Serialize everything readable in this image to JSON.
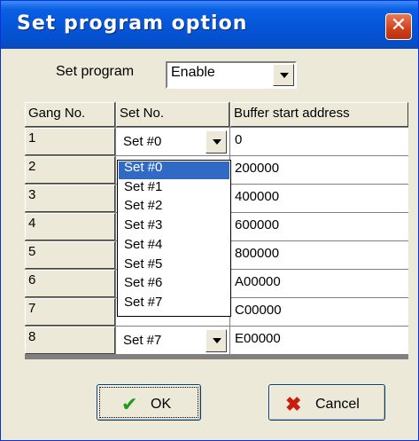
{
  "window": {
    "title": "Set program option"
  },
  "set_program": {
    "label": "Set program",
    "value": "Enable"
  },
  "table": {
    "headers": [
      "Gang No.",
      "Set No.",
      "Buffer start address"
    ],
    "rows": [
      {
        "gang": "1",
        "set": "Set #0",
        "address": "0"
      },
      {
        "gang": "2",
        "set": "",
        "address": "200000"
      },
      {
        "gang": "3",
        "set": "",
        "address": "400000"
      },
      {
        "gang": "4",
        "set": "",
        "address": "600000"
      },
      {
        "gang": "5",
        "set": "",
        "address": "800000"
      },
      {
        "gang": "6",
        "set": "",
        "address": "A00000"
      },
      {
        "gang": "7",
        "set": "",
        "address": "C00000"
      },
      {
        "gang": "8",
        "set": "Set #7",
        "address": "E00000"
      }
    ]
  },
  "dropdown": {
    "options": [
      "Set #0",
      "Set #1",
      "Set #2",
      "Set #3",
      "Set #4",
      "Set #5",
      "Set #6",
      "Set #7"
    ],
    "selected": "Set #0"
  },
  "buttons": {
    "ok": "OK",
    "cancel": "Cancel"
  },
  "icons": {
    "close": "close-icon",
    "ok": "checkmark-icon",
    "cancel": "x-icon"
  },
  "colors": {
    "titlebar": "#0656d9",
    "selection": "#316ac5",
    "checkmark": "#1f9a1f",
    "cancel_x": "#c81e0f"
  }
}
